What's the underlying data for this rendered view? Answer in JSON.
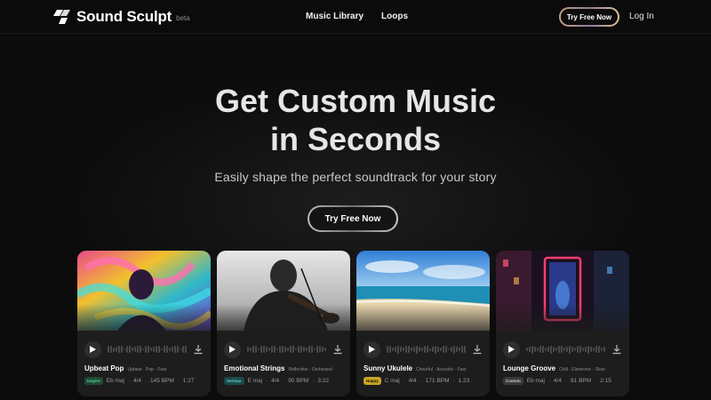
{
  "nav": {
    "logo_text": "Sound Sculpt",
    "logo_badge": "beta",
    "links": [
      "Music Library",
      "Loops"
    ],
    "cta_label": "Try Free Now",
    "login_label": "Log In"
  },
  "hero": {
    "title_line1": "Get Custom Music",
    "title_line2": "in Seconds",
    "subtitle": "Easily shape the perfect soundtrack for your story",
    "cta_label": "Try Free Now"
  },
  "cards": [
    {
      "title": "Upbeat Pop",
      "tags": "Upbeat · Pop · Fast",
      "mood": "Inspire",
      "mood_bg": "#1f4a35",
      "mood_fg": "#58d08e",
      "key": "Eb maj",
      "time": "4/4",
      "bpm": "145 BPM",
      "duration": "1:27"
    },
    {
      "title": "Emotional Strings",
      "tags": "Reflective · Orchestral ·",
      "mood": "Serious",
      "mood_bg": "#1d4a4a",
      "mood_fg": "#5ed0c8",
      "key": "E maj",
      "time": "4/4",
      "bpm": "90 BPM",
      "duration": "3:22"
    },
    {
      "title": "Sunny Ukulele",
      "tags": "Cheerful · Acoustic · Fast",
      "mood": "Happy",
      "mood_bg": "#c9a526",
      "mood_fg": "#1a1400",
      "key": "C maj",
      "time": "4/4",
      "bpm": "171 BPM",
      "duration": "1:23"
    },
    {
      "title": "Lounge Groove",
      "tags": "Chill · Electronic · Slow",
      "mood": "Custom",
      "mood_bg": "#3a3a3a",
      "mood_fg": "#d0d0d0",
      "key": "Eb maj",
      "time": "4/4",
      "bpm": "81 BPM",
      "duration": "2:15"
    }
  ],
  "icons": {
    "logo": "sound-sculpt-logo-icon",
    "play": "play-icon",
    "download": "download-icon"
  },
  "colors": {
    "background": "#0c0c0c",
    "card": "#1d1d1d"
  }
}
